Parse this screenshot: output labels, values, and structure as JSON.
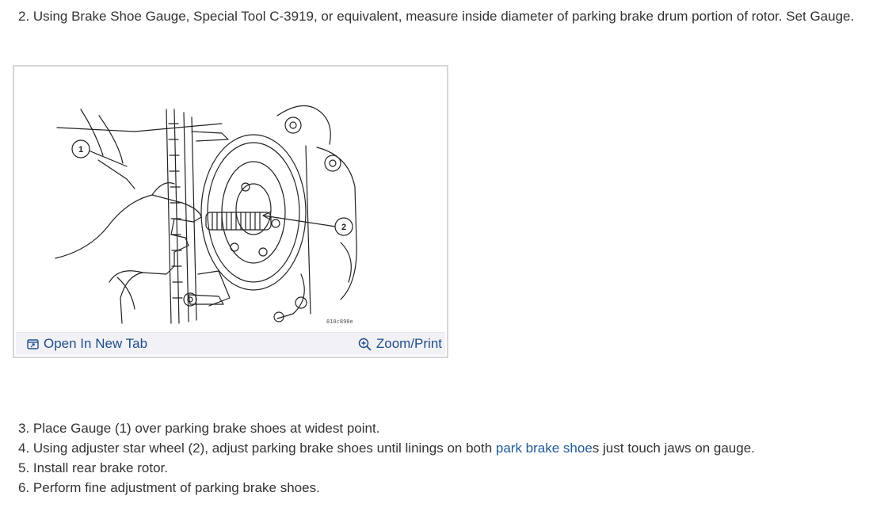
{
  "step2": "2. Using Brake Shoe Gauge, Special Tool C-3919, or equivalent, measure inside diameter of parking brake drum portion of rotor. Set Gauge.",
  "figure": {
    "callout_1": "1",
    "callout_2": "2",
    "image_code": "810c898e",
    "open_new_tab_label": "Open In New Tab",
    "zoom_print_label": "Zoom/Print",
    "icons": {
      "open_tab": "open-new-tab-icon",
      "zoom": "zoom-in-icon"
    }
  },
  "steps": {
    "step3": "3. Place Gauge (1) over parking brake shoes at widest point.",
    "step4_before": "4. Using adjuster star wheel (2), adjust parking brake shoes until linings on both ",
    "step4_link": "park brake shoe",
    "step4_after": "s just touch jaws on gauge.",
    "step5": "5. Install rear brake rotor.",
    "step6": "6. Perform fine adjustment of parking brake shoes."
  },
  "colors": {
    "link": "#1f5a9c",
    "text": "#333333",
    "bar": "#f2f2f6"
  }
}
